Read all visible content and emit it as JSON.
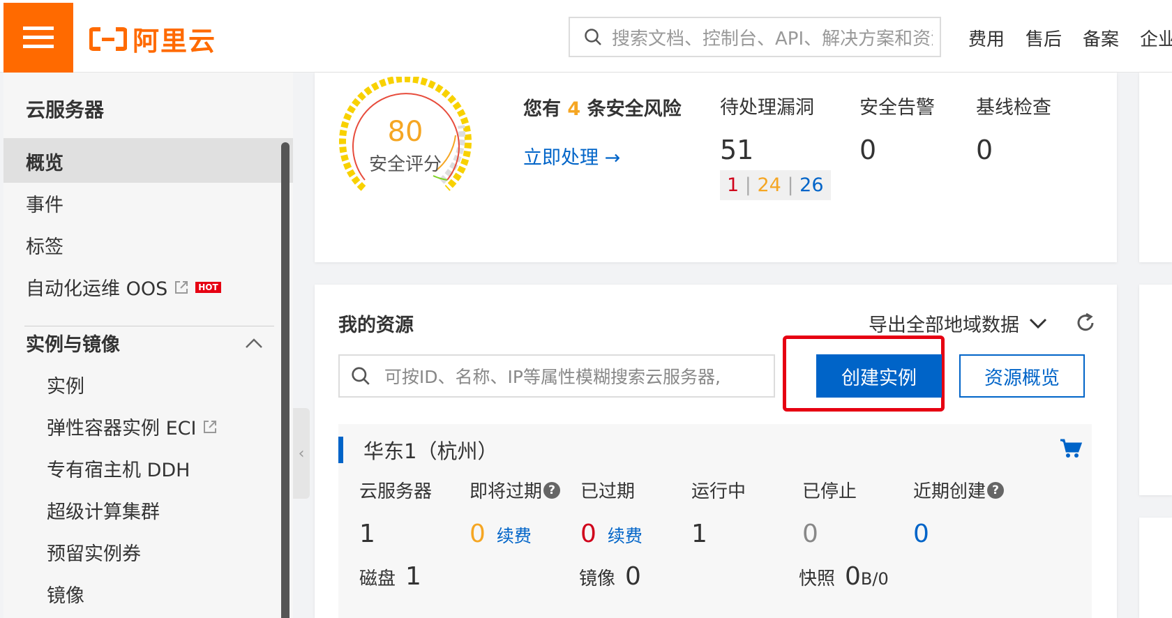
{
  "header": {
    "logo_text": "阿里云",
    "search_placeholder": "搜索文档、控制台、API、解决方案和资源",
    "nav": [
      "费用",
      "售后",
      "备案",
      "企业"
    ]
  },
  "sidebar": {
    "title": "云服务器",
    "items": [
      {
        "label": "概览"
      },
      {
        "label": "事件"
      },
      {
        "label": "标签"
      },
      {
        "label": "自动化运维 OOS",
        "badge": "HOT"
      }
    ],
    "group": {
      "label": "实例与镜像",
      "items": [
        "实例",
        "弹性容器实例 ECI",
        "专有宿主机 DDH",
        "超级计算集群",
        "预留实例券",
        "镜像"
      ]
    }
  },
  "security": {
    "score": "80",
    "score_label": "安全评分",
    "score_value": 80,
    "risk_prefix": "您有",
    "risk_count": "4",
    "risk_suffix": "条安全风险",
    "action_link": "立即处理 →",
    "stats": [
      {
        "label": "待处理漏洞",
        "value": "51"
      },
      {
        "label": "安全告警",
        "value": "0"
      },
      {
        "label": "基线检查",
        "value": "0"
      }
    ],
    "severity": {
      "high": "1",
      "medium": "24",
      "low": "26",
      "sep": "|"
    }
  },
  "resources": {
    "title": "我的资源",
    "export_label": "导出全部地域数据",
    "search_placeholder": "可按ID、名称、IP等属性模糊搜索云服务器,",
    "create_button": "创建实例",
    "overview_button": "资源概览",
    "region": {
      "name": "华东1（杭州）",
      "stats": [
        {
          "label": "云服务器",
          "value": "1"
        },
        {
          "label": "即将过期",
          "value": "0",
          "renew": "续费",
          "help": "?"
        },
        {
          "label": "已过期",
          "value": "0",
          "renew": "续费"
        },
        {
          "label": "运行中",
          "value": "1"
        },
        {
          "label": "已停止",
          "value": "0"
        },
        {
          "label": "近期创建",
          "value": "0",
          "help": "?"
        }
      ],
      "disk_label": "磁盘",
      "disk_value": "1",
      "image_label": "镜像",
      "image_value": "0",
      "snapshot_label": "快照",
      "snapshot_value": "0",
      "snapshot_unit": "B/0"
    }
  },
  "colors": {
    "brand": "#ff6a00",
    "primary": "#0064c8",
    "highlight": "#e60012",
    "warning": "#f5a623",
    "danger": "#d0021b"
  }
}
